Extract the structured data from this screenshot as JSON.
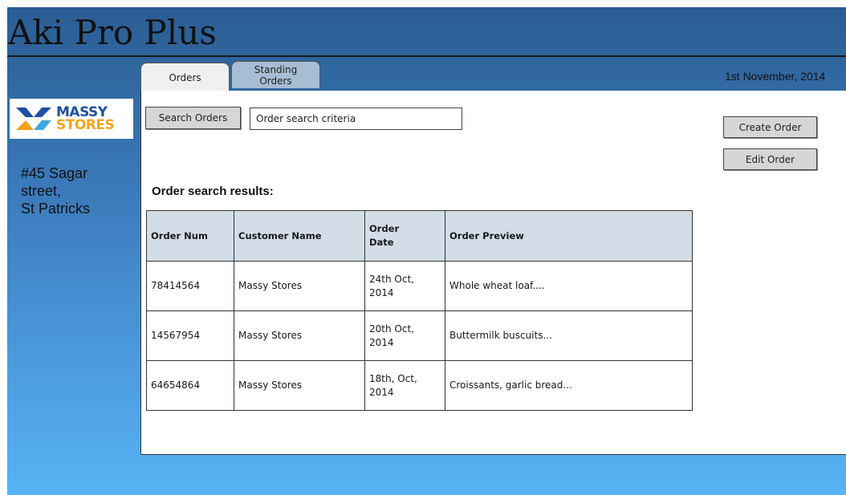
{
  "app": {
    "title": "Aki Pro Plus"
  },
  "header": {
    "date": "1st November, 2014"
  },
  "logo": {
    "line1": "MASSY",
    "line2": "STORES"
  },
  "address": {
    "line1": "#45 Sagar",
    "line2": "street,",
    "line3": "St Patricks"
  },
  "tabs": [
    {
      "label": "Orders"
    },
    {
      "label_line1": "Standing",
      "label_line2": "Orders"
    }
  ],
  "search": {
    "button_label": "Search Orders",
    "value": "Order search criteria"
  },
  "actions": {
    "create_label": "Create Order",
    "edit_label": "Edit Order"
  },
  "results": {
    "label": "Order search results:",
    "columns": [
      {
        "line1": "Order Num",
        "line2": ""
      },
      {
        "line1": "Customer Name",
        "line2": ""
      },
      {
        "line1": "Order",
        "line2": "Date"
      },
      {
        "line1": "Order Preview",
        "line2": ""
      }
    ],
    "rows": [
      {
        "num": "78414564",
        "customer": "Massy Stores",
        "date_line1": "24th Oct,",
        "date_line2": "2014",
        "preview": "Whole wheat loaf...."
      },
      {
        "num": "14567954",
        "customer": "Massy Stores",
        "date_line1": "20th Oct,",
        "date_line2": "2014",
        "preview": "Buttermilk buscuits..."
      },
      {
        "num": "64654864",
        "customer": "Massy Stores",
        "date_line1": "18th, Oct,",
        "date_line2": "2014",
        "preview": "Croissants, garlic bread..."
      }
    ]
  },
  "colors": {
    "frame_top": "#2a5d92",
    "frame_bottom": "#56b4f4",
    "logo_blue": "#1e4fa3",
    "logo_orange": "#f2a419",
    "tab_inactive": "#a7bdd3",
    "table_header": "#d3dde8"
  }
}
